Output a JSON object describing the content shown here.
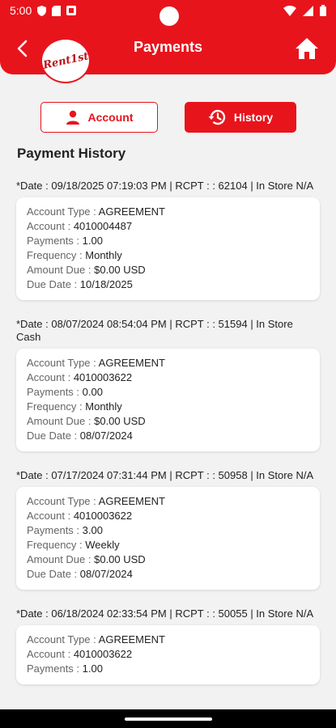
{
  "status_bar": {
    "time": "5:00"
  },
  "header": {
    "title": "Payments"
  },
  "logo": {
    "text": "Rent1st"
  },
  "tabs": {
    "account_label": "Account",
    "history_label": "History"
  },
  "section_title": "Payment History",
  "labels": {
    "account_type": "Account Type : ",
    "account": "Account : ",
    "payments": "Payments : ",
    "frequency": "Frequency : ",
    "amount_due": "Amount Due : ",
    "due_date": "Due Date : "
  },
  "history": [
    {
      "header": "*Date : 09/18/2025 07:19:03 PM | RCPT : : 62104 | In Store N/A",
      "account_type": "AGREEMENT",
      "account": "4010004487",
      "payments": "1.00",
      "frequency": "Monthly",
      "amount_due": "$0.00 USD",
      "due_date": "10/18/2025"
    },
    {
      "header": "*Date : 08/07/2024 08:54:04 PM | RCPT : : 51594 | In Store Cash",
      "account_type": "AGREEMENT",
      "account": "4010003622",
      "payments": "0.00",
      "frequency": "Monthly",
      "amount_due": "$0.00 USD",
      "due_date": "08/07/2024"
    },
    {
      "header": "*Date : 07/17/2024 07:31:44 PM | RCPT : : 50958 | In Store N/A",
      "account_type": "AGREEMENT",
      "account": "4010003622",
      "payments": "3.00",
      "frequency": "Weekly",
      "amount_due": "$0.00 USD",
      "due_date": "08/07/2024"
    },
    {
      "header": "*Date : 06/18/2024 02:33:54 PM | RCPT : : 50055 | In Store N/A",
      "account_type": "AGREEMENT",
      "account": "4010003622",
      "payments": "1.00",
      "frequency": "",
      "amount_due": "",
      "due_date": ""
    }
  ],
  "colors": {
    "brand_red": "#e8141c",
    "background": "#f2f2f2"
  }
}
